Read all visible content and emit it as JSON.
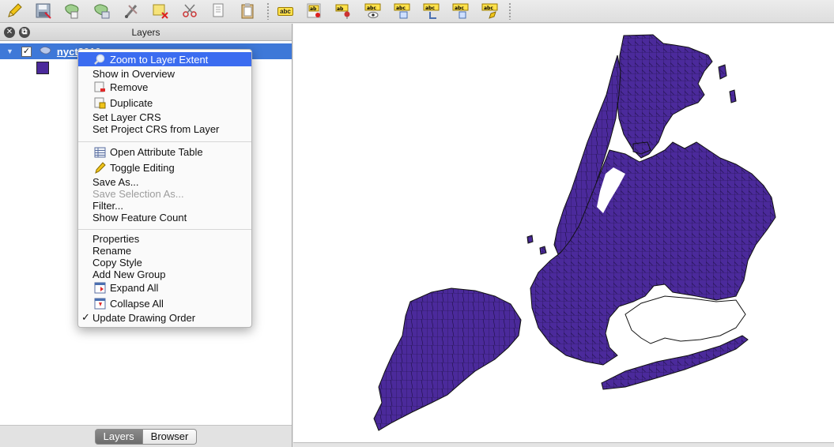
{
  "toolbar": {
    "icons": [
      "pencil-icon",
      "save-edits-icon",
      "add-part-icon",
      "fill-ring-icon",
      "node-tool-icon",
      "delete-selected-icon",
      "cut-features-icon",
      "copy-features-icon",
      "paste-features-icon",
      "label-toolbar-icon",
      "layer-labeling-icon",
      "pin-labels-icon",
      "highlight-pinned-labels-icon",
      "show-hide-labels-icon",
      "move-label-icon",
      "rotate-label-icon",
      "change-label-icon"
    ],
    "abc_text": "abc",
    "ab_text": "ab"
  },
  "layers_panel": {
    "title": "Layers",
    "layer_name": "nyct2010",
    "layer_color": "#4b2a9b",
    "tabs": [
      {
        "label": "Layers",
        "active": true
      },
      {
        "label": "Browser",
        "active": false
      }
    ]
  },
  "context_menu": {
    "items": [
      {
        "label": "Zoom to Layer Extent",
        "icon": "zoom-icon",
        "highlighted": true
      },
      {
        "label": "Show in Overview"
      },
      {
        "label": "Remove",
        "icon": "remove-layer-icon"
      },
      {
        "label": "Duplicate",
        "icon": "duplicate-layer-icon"
      },
      {
        "label": "Set Layer CRS"
      },
      {
        "label": "Set Project CRS from Layer"
      },
      {
        "label": "Open Attribute Table",
        "icon": "attribute-table-icon"
      },
      {
        "label": "Toggle Editing",
        "icon": "pencil-icon"
      },
      {
        "label": "Save As..."
      },
      {
        "label": "Save Selection As...",
        "disabled": true
      },
      {
        "label": "Filter..."
      },
      {
        "label": "Show Feature Count"
      },
      {
        "label": "Properties"
      },
      {
        "label": "Rename"
      },
      {
        "label": "Copy Style"
      },
      {
        "label": "Add New Group"
      },
      {
        "label": "Expand All",
        "icon": "expand-all-icon"
      },
      {
        "label": "Collapse All",
        "icon": "collapse-all-icon"
      },
      {
        "label": "Update Drawing Order",
        "checked": true
      }
    ]
  },
  "map": {
    "fill_color": "#4b2a9b",
    "stroke_color": "#111111"
  },
  "colors": {
    "selection": "#3e78d8",
    "menu_highlight": "#3b6cf0"
  }
}
